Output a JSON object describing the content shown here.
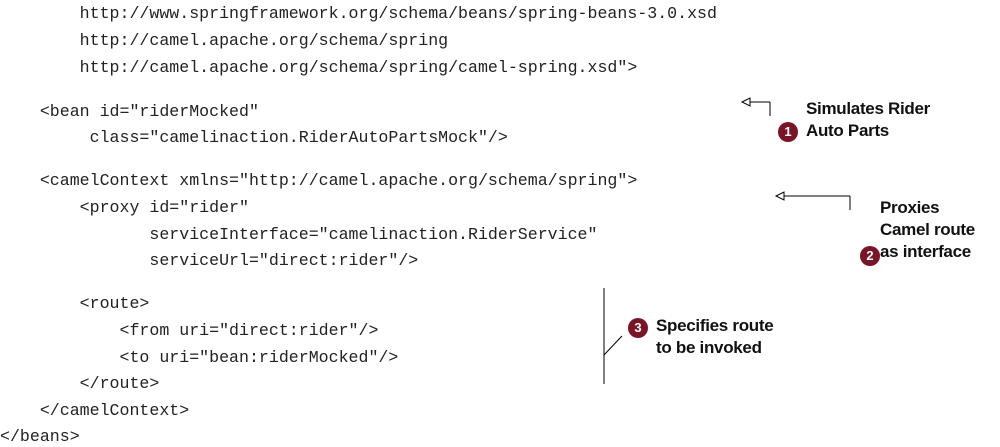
{
  "code_lines": [
    "        http://www.springframework.org/schema/beans/spring-beans-3.0.xsd",
    "        http://camel.apache.org/schema/spring",
    "        http://camel.apache.org/schema/spring/camel-spring.xsd\">",
    "    <bean id=\"riderMocked\"",
    "         class=\"camelinaction.RiderAutoPartsMock\"/>",
    "    <camelContext xmlns=\"http://camel.apache.org/schema/spring\">",
    "        <proxy id=\"rider\"",
    "               serviceInterface=\"camelinaction.RiderService\"",
    "               serviceUrl=\"direct:rider\"/>",
    "        <route>",
    "            <from uri=\"direct:rider\"/>",
    "            <to uri=\"bean:riderMocked\"/>",
    "        </route>",
    "    </camelContext>",
    "</beans>"
  ],
  "callouts": [
    {
      "number": "1",
      "lines": [
        "Simulates Rider",
        "Auto Parts"
      ]
    },
    {
      "number": "2",
      "lines": [
        "Proxies",
        "Camel route",
        "as interface"
      ]
    },
    {
      "number": "3",
      "lines": [
        "Specifies route",
        "to be invoked"
      ]
    }
  ],
  "colors": {
    "text": "#222222",
    "badge": "#7a1526",
    "annotation_line": "#000000"
  }
}
